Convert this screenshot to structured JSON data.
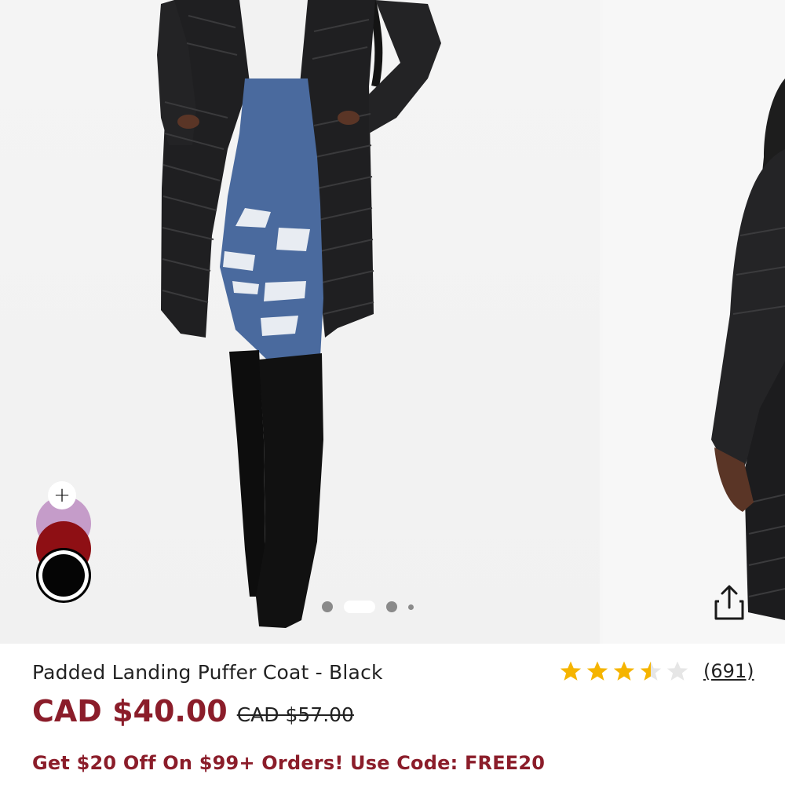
{
  "product": {
    "title": "Padded Landing Puffer Coat - Black",
    "price": "CAD $40.00",
    "original_price": "CAD $57.00",
    "promo": "Get $20 Off On $99+ Orders! Use Code: FREE20",
    "rating": 3.5,
    "review_count": "(691)"
  },
  "gallery": {
    "slide_count": 4,
    "active_slide": 2,
    "swatches": [
      "lavender",
      "burgundy",
      "black"
    ],
    "add_symbol": "+",
    "selected_swatch": "black"
  },
  "icons": {
    "share": "share-icon",
    "add": "plus-icon",
    "star": "star-icon"
  },
  "colors": {
    "price": "#8b1d2a",
    "star": "#f5b400",
    "star_empty": "#e6e6e6"
  }
}
